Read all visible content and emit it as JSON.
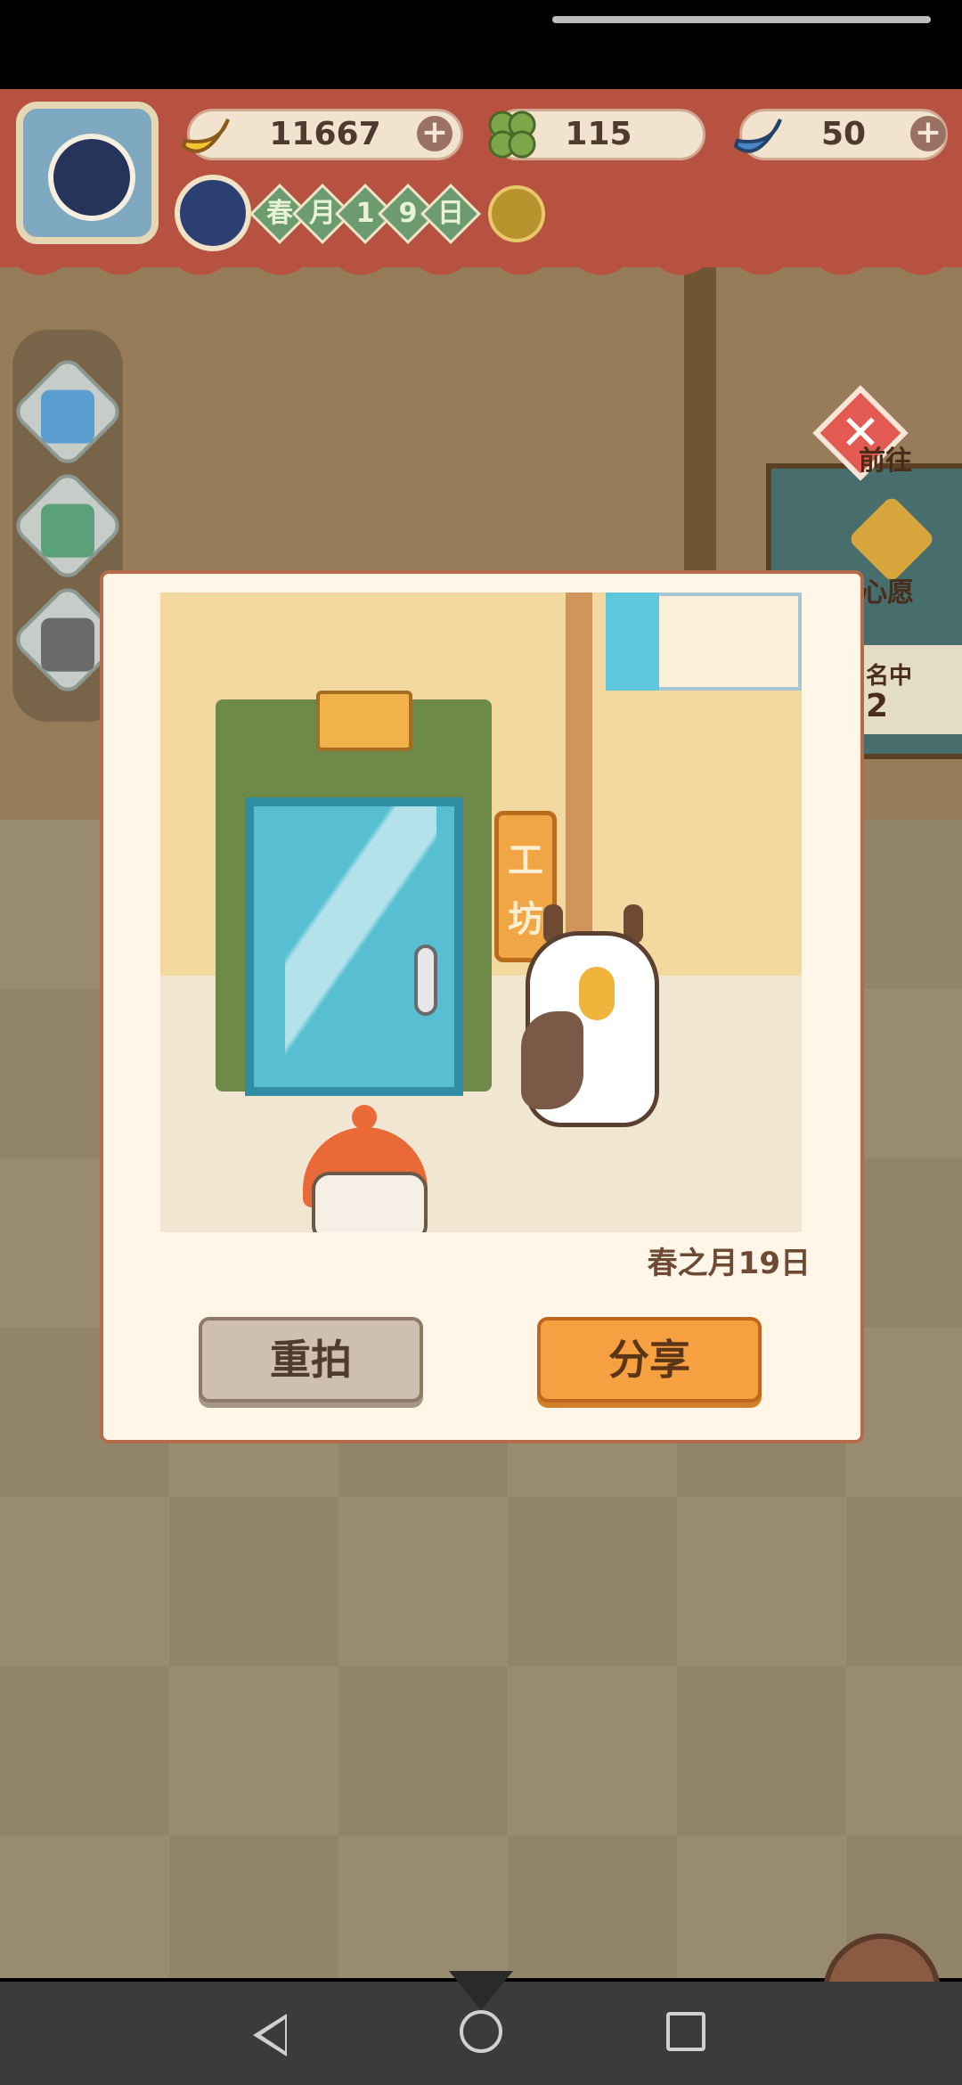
{
  "hud": {
    "bananas": "11667",
    "clovers": "115",
    "blue_bananas": "50",
    "date_chars": [
      "春",
      "月",
      "1",
      "9",
      "日"
    ]
  },
  "side_right": {
    "goto_label": "前往",
    "wish_label": "心愿",
    "rank_label": "名中",
    "rank_value": "2"
  },
  "photo": {
    "sign_chars": [
      "工",
      "坊"
    ],
    "date": "春之月19日"
  },
  "dialog": {
    "retake_label": "重拍",
    "share_label": "分享"
  },
  "colors": {
    "awning": "#b75240",
    "dialog_bg": "#fff6e8",
    "share_button": "#f5a142",
    "retake_button": "#cfbfae"
  },
  "icons": [
    "banana-icon",
    "clover-icon",
    "blue-banana-icon",
    "plus-icon",
    "moon-icon",
    "sun-icon",
    "tv-icon",
    "shop-icon",
    "camera-icon",
    "close-icon",
    "heart-icon",
    "yarn-ball-icon",
    "back-icon",
    "home-icon",
    "recent-apps-icon"
  ]
}
